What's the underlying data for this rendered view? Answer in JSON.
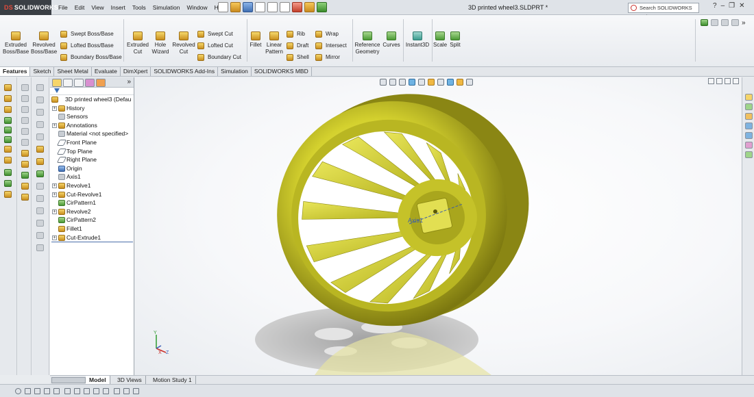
{
  "app": {
    "brand": "SOLIDWORKS",
    "document_title": "3D printed wheel3.SLDPRT *"
  },
  "menu": [
    "File",
    "Edit",
    "View",
    "Insert",
    "Tools",
    "Simulation",
    "Window",
    "Help"
  ],
  "search": {
    "placeholder": "Search SOLIDWORKS Help"
  },
  "ribbon": {
    "extruded_boss": [
      "Extruded",
      "Boss/Base"
    ],
    "revolved_boss": [
      "Revolved",
      "Boss/Base"
    ],
    "swept_boss": "Swept Boss/Base",
    "lofted_boss": "Lofted Boss/Base",
    "boundary_boss": "Boundary Boss/Base",
    "extruded_cut": [
      "Extruded",
      "Cut"
    ],
    "hole_wizard": [
      "Hole",
      "Wizard"
    ],
    "revolved_cut": [
      "Revolved",
      "Cut"
    ],
    "swept_cut": "Swept Cut",
    "lofted_cut": "Lofted Cut",
    "boundary_cut": "Boundary Cut",
    "fillet": "Fillet",
    "linear_pattern": [
      "Linear",
      "Pattern"
    ],
    "rib": "Rib",
    "draft": "Draft",
    "shell": "Shell",
    "wrap": "Wrap",
    "intersect": "Intersect",
    "mirror": "Mirror",
    "reference_geometry": [
      "Reference",
      "Geometry"
    ],
    "curves": "Curves",
    "instant3d": "Instant3D",
    "scale": "Scale",
    "split": "Split"
  },
  "tabs": [
    "Features",
    "Sketch",
    "Sheet Metal",
    "Evaluate",
    "DimXpert",
    "SOLIDWORKS Add-Ins",
    "Simulation",
    "SOLIDWORKS MBD"
  ],
  "tree": {
    "root": "3D printed wheel3  (Defau",
    "items": [
      {
        "label": "History",
        "icon": "history-icon",
        "expand": true
      },
      {
        "label": "Sensors",
        "icon": "sensors-icon",
        "expand": false
      },
      {
        "label": "Annotations",
        "icon": "annotations-icon",
        "expand": true
      },
      {
        "label": "Material <not specified>",
        "icon": "material-icon",
        "expand": false
      },
      {
        "label": "Front Plane",
        "icon": "plane-icon",
        "expand": false
      },
      {
        "label": "Top Plane",
        "icon": "plane-icon",
        "expand": false
      },
      {
        "label": "Right Plane",
        "icon": "plane-icon",
        "expand": false
      },
      {
        "label": "Origin",
        "icon": "origin-icon",
        "expand": false
      },
      {
        "label": "Axis1",
        "icon": "axis-icon",
        "expand": false
      },
      {
        "label": "Revolve1",
        "icon": "revolve-icon",
        "expand": true
      },
      {
        "label": "Cut-Revolve1",
        "icon": "cut-revolve-icon",
        "expand": true
      },
      {
        "label": "CirPattern1",
        "icon": "circular-pattern-icon",
        "expand": false
      },
      {
        "label": "Revolve2",
        "icon": "revolve-icon",
        "expand": true
      },
      {
        "label": "CirPattern2",
        "icon": "circular-pattern-icon",
        "expand": false
      },
      {
        "label": "Fillet1",
        "icon": "fillet-icon",
        "expand": false
      },
      {
        "label": "Cut-Extrude1",
        "icon": "cut-extrude-icon",
        "expand": true
      }
    ]
  },
  "viewport": {
    "axis_label": "Axis1",
    "triad": {
      "x": "X",
      "y": "Y",
      "z": "Z"
    }
  },
  "bottom_tabs": [
    "Model",
    "3D Views",
    "Motion Study 1"
  ],
  "colors": {
    "part": "#d6d43a",
    "part_dark": "#6d6a10",
    "accent": "#3f6fb3"
  }
}
